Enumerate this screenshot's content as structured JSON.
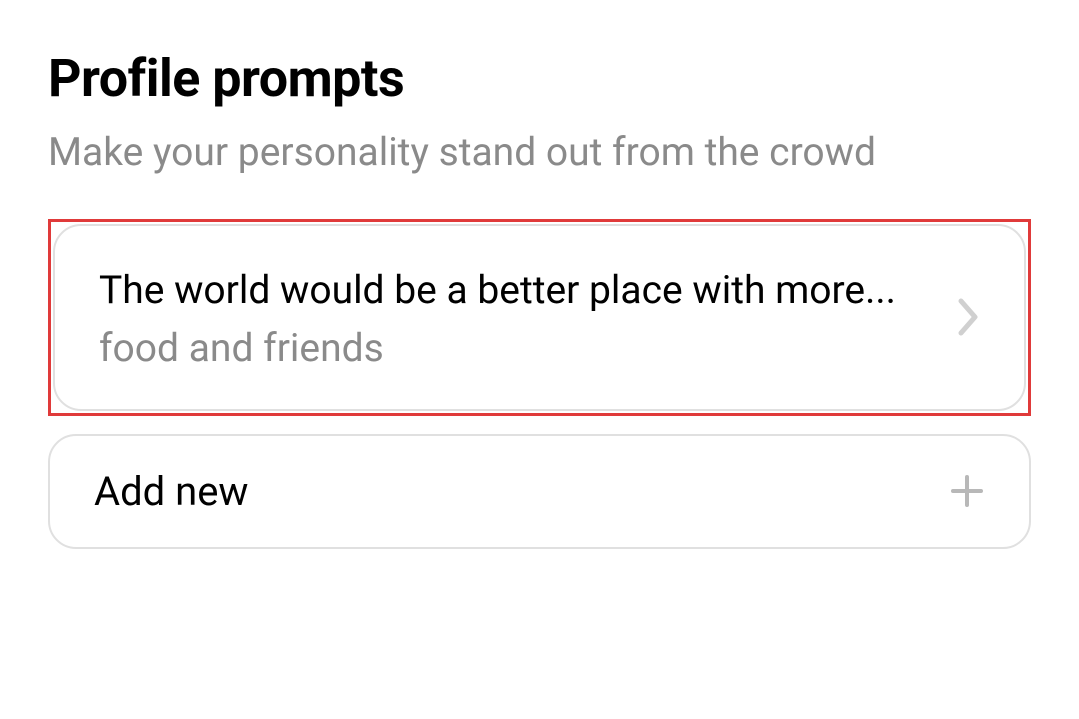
{
  "header": {
    "title": "Profile prompts",
    "subtitle": "Make your personality stand out from the crowd"
  },
  "prompts": [
    {
      "question": "The world would be a better place with more...",
      "answer": "food and friends"
    }
  ],
  "addNew": {
    "label": "Add new"
  },
  "icons": {
    "chevron": "chevron-right-icon",
    "plus": "plus-icon"
  },
  "colors": {
    "highlight": "#e03a3a",
    "text": "#000000",
    "muted": "#8a8a8a",
    "border": "#e0e0e0",
    "iconMuted": "#c7c7c7"
  }
}
